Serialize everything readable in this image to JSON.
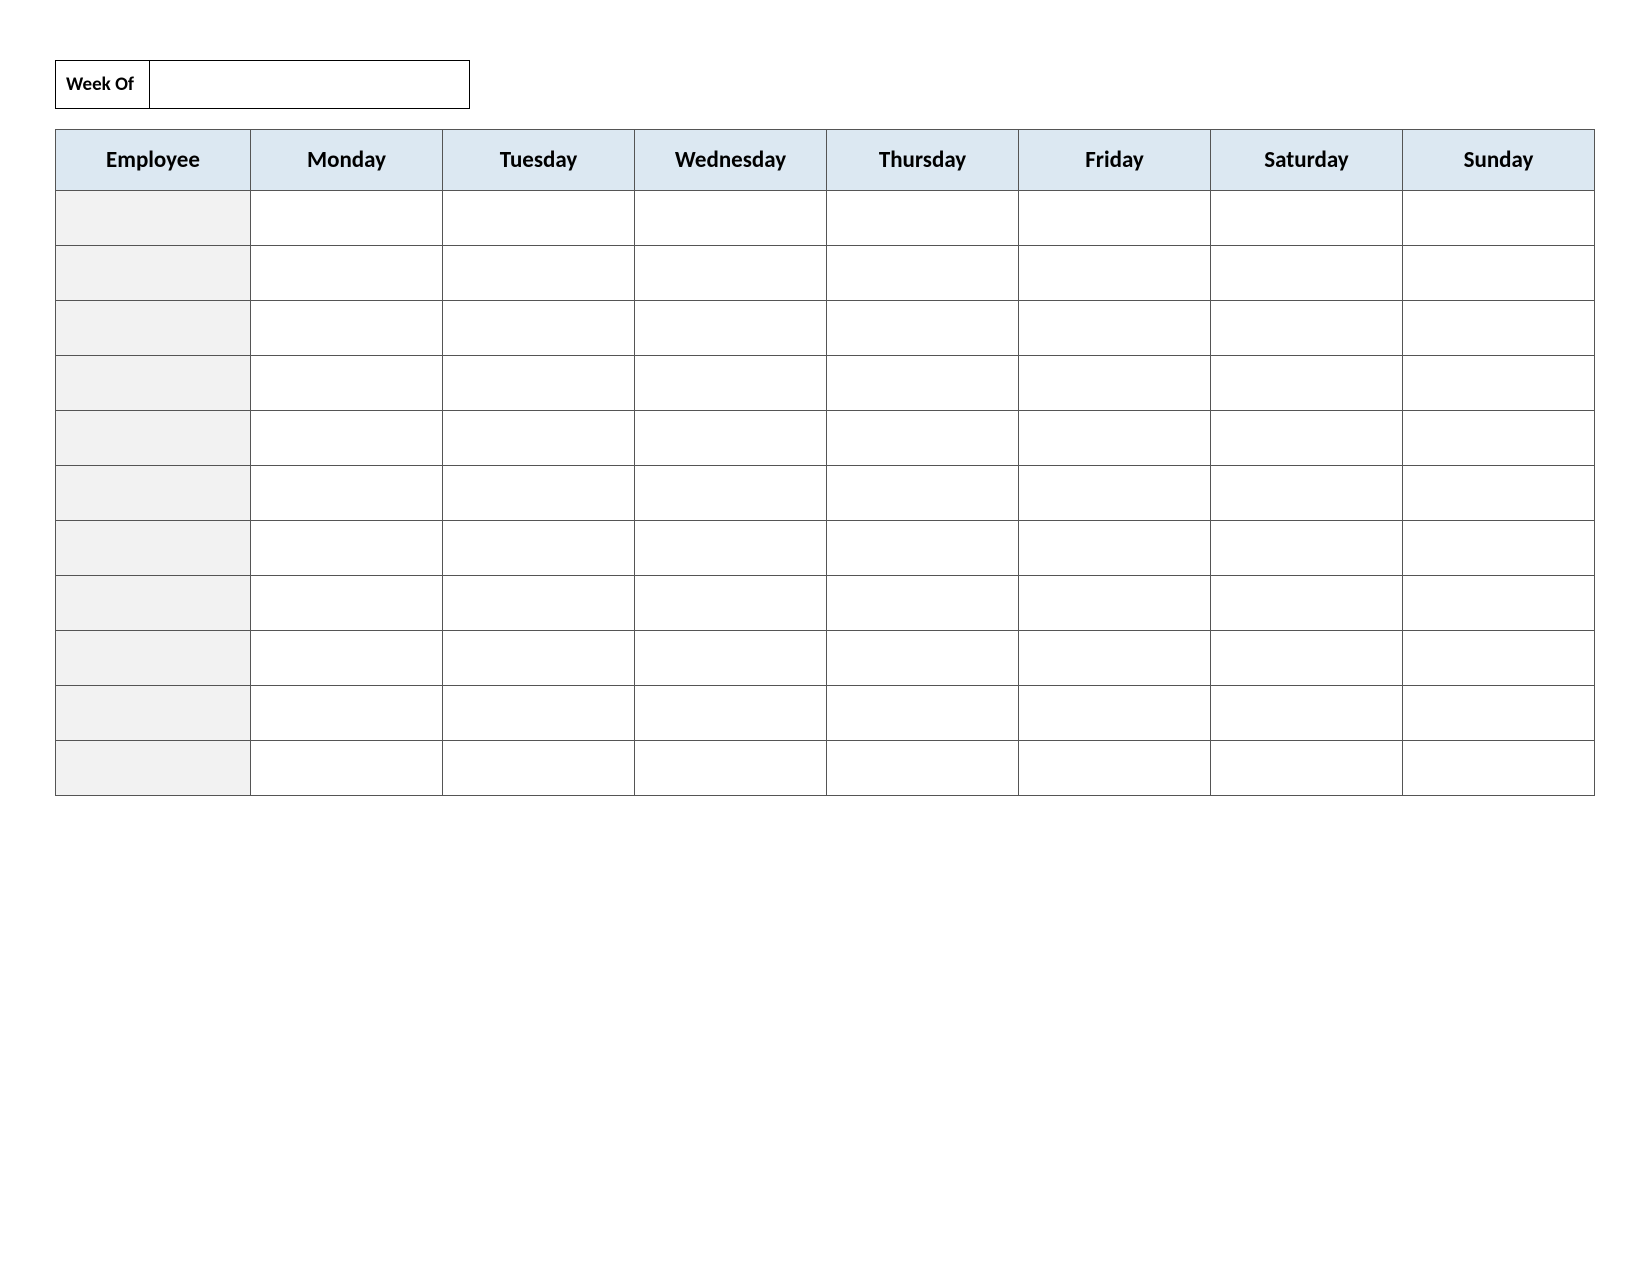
{
  "header": {
    "week_of_label": "Week Of",
    "week_of_value": ""
  },
  "table": {
    "columns": [
      "Employee",
      "Monday",
      "Tuesday",
      "Wednesday",
      "Thursday",
      "Friday",
      "Saturday",
      "Sunday"
    ],
    "rows": [
      {
        "employee": "",
        "mon": "",
        "tue": "",
        "wed": "",
        "thu": "",
        "fri": "",
        "sat": "",
        "sun": ""
      },
      {
        "employee": "",
        "mon": "",
        "tue": "",
        "wed": "",
        "thu": "",
        "fri": "",
        "sat": "",
        "sun": ""
      },
      {
        "employee": "",
        "mon": "",
        "tue": "",
        "wed": "",
        "thu": "",
        "fri": "",
        "sat": "",
        "sun": ""
      },
      {
        "employee": "",
        "mon": "",
        "tue": "",
        "wed": "",
        "thu": "",
        "fri": "",
        "sat": "",
        "sun": ""
      },
      {
        "employee": "",
        "mon": "",
        "tue": "",
        "wed": "",
        "thu": "",
        "fri": "",
        "sat": "",
        "sun": ""
      },
      {
        "employee": "",
        "mon": "",
        "tue": "",
        "wed": "",
        "thu": "",
        "fri": "",
        "sat": "",
        "sun": ""
      },
      {
        "employee": "",
        "mon": "",
        "tue": "",
        "wed": "",
        "thu": "",
        "fri": "",
        "sat": "",
        "sun": ""
      },
      {
        "employee": "",
        "mon": "",
        "tue": "",
        "wed": "",
        "thu": "",
        "fri": "",
        "sat": "",
        "sun": ""
      },
      {
        "employee": "",
        "mon": "",
        "tue": "",
        "wed": "",
        "thu": "",
        "fri": "",
        "sat": "",
        "sun": ""
      },
      {
        "employee": "",
        "mon": "",
        "tue": "",
        "wed": "",
        "thu": "",
        "fri": "",
        "sat": "",
        "sun": ""
      },
      {
        "employee": "",
        "mon": "",
        "tue": "",
        "wed": "",
        "thu": "",
        "fri": "",
        "sat": "",
        "sun": ""
      }
    ]
  }
}
